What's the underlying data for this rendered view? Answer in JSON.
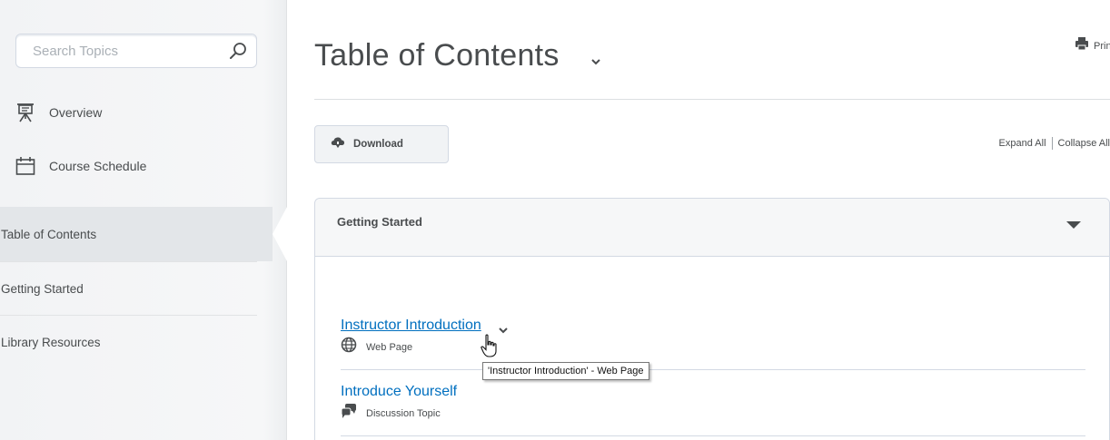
{
  "search": {
    "placeholder": "Search Topics"
  },
  "sidebar": {
    "top_items": [
      {
        "label": "Overview",
        "icon": "presentation-board-icon"
      },
      {
        "label": "Course Schedule",
        "icon": "calendar-icon"
      }
    ],
    "sections": [
      {
        "label": "Table of Contents",
        "active": true
      },
      {
        "label": "Getting Started",
        "active": false
      },
      {
        "label": "Library Resources",
        "active": false
      }
    ]
  },
  "main": {
    "title": "Table of Contents",
    "print_label": "Print",
    "download_label": "Download",
    "expand_all": "Expand All",
    "collapse_all": "Collapse All",
    "module": {
      "title": "Getting Started",
      "topics": [
        {
          "title": "Instructor Introduction",
          "type": "Web Page",
          "icon": "globe-icon"
        },
        {
          "title": "Introduce Yourself",
          "type": "Discussion Topic",
          "icon": "discussion-icon"
        }
      ]
    },
    "tooltip": "'Instructor Introduction' - Web Page"
  },
  "colors": {
    "link": "#006fbf",
    "text": "#494c4e",
    "border": "#d3d9e3"
  }
}
